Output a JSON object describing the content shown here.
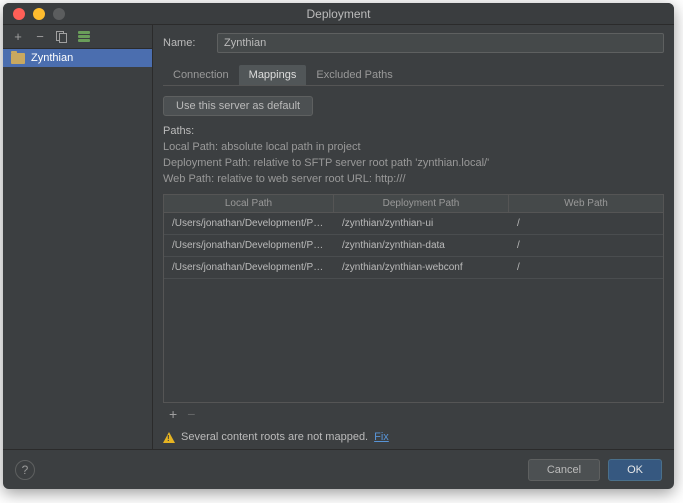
{
  "window": {
    "title": "Deployment"
  },
  "sidebar": {
    "items": [
      {
        "label": "Zynthian"
      }
    ]
  },
  "form": {
    "name_label": "Name:",
    "name_value": "Zynthian",
    "tabs": [
      {
        "label": "Connection"
      },
      {
        "label": "Mappings"
      },
      {
        "label": "Excluded Paths"
      }
    ],
    "default_button": "Use this server as default",
    "paths_heading": "Paths:",
    "path_hints": {
      "local": "Local Path: absolute local path in project",
      "deploy": "Deployment Path: relative to SFTP server root path 'zynthian.local/'",
      "web": "Web Path: relative to web server root URL: http:///"
    }
  },
  "table": {
    "headers": {
      "local": "Local Path",
      "deploy": "Deployment Path",
      "web": "Web Path"
    },
    "rows": [
      {
        "local": "/Users/jonathan/Development/Pycha…",
        "deploy": "/zynthian/zynthian-ui",
        "web": "/"
      },
      {
        "local": "/Users/jonathan/Development/Pycha…",
        "deploy": "/zynthian/zynthian-data",
        "web": "/"
      },
      {
        "local": "/Users/jonathan/Development/Pycha…",
        "deploy": "/zynthian/zynthian-webconf",
        "web": "/"
      }
    ]
  },
  "warning": {
    "text": "Several content roots are not mapped.",
    "fix": "Fix"
  },
  "footer": {
    "cancel": "Cancel",
    "ok": "OK"
  }
}
